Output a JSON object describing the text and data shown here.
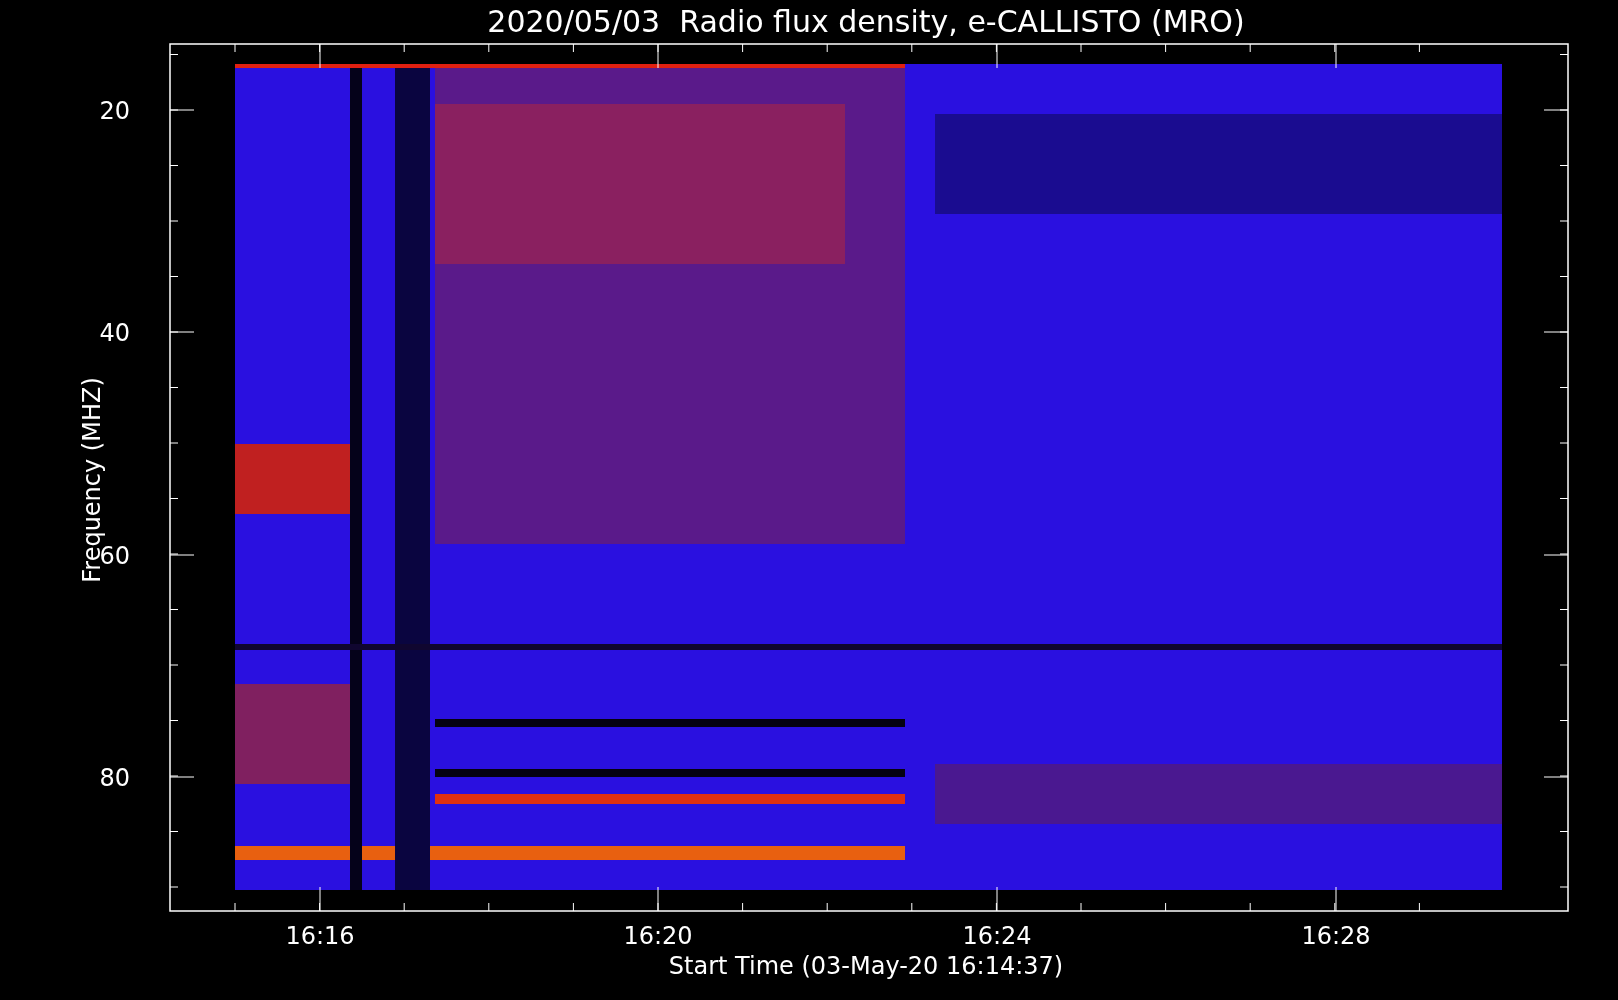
{
  "title": "2020/05/03  Radio flux density, e-CALLISTO (MRO)",
  "y_axis": {
    "label": "Frequency (MHZ)",
    "ticks": [
      "20",
      "40",
      "60",
      "80"
    ]
  },
  "x_axis": {
    "label": "Start Time (03-May-20 16:14:37)",
    "ticks": [
      "16:16",
      "16:20",
      "16:24",
      "16:28"
    ]
  }
}
